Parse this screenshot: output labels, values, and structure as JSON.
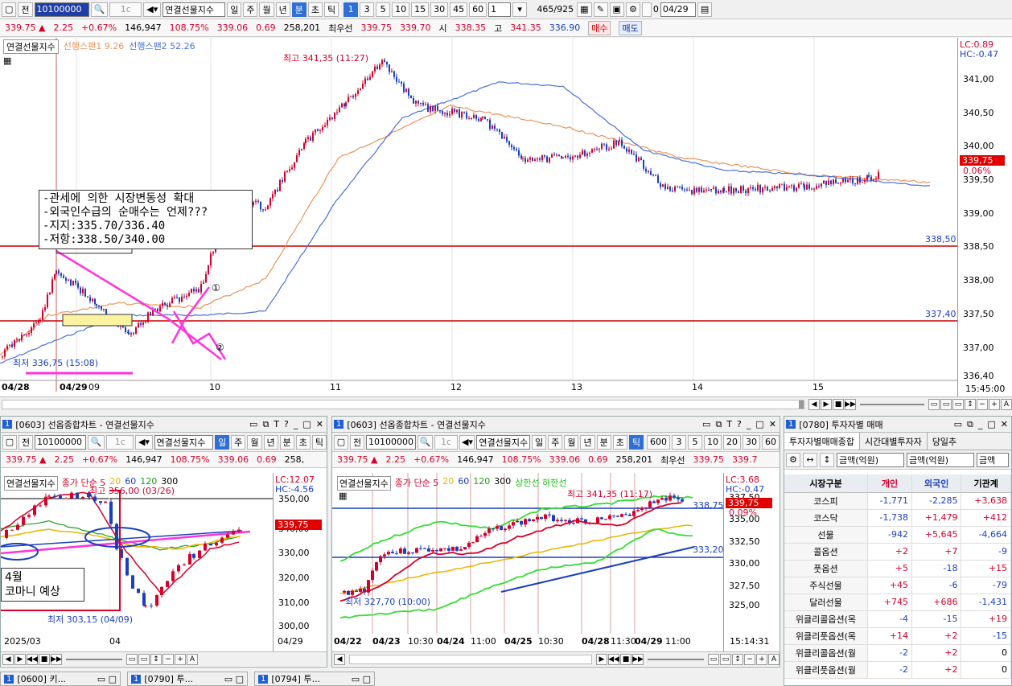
{
  "main": {
    "toolbar": {
      "btn_jeon": "전",
      "code": "10100000",
      "instrument": "연결선물지수",
      "periods": [
        "일",
        "주",
        "월",
        "년",
        "분",
        "초",
        "틱"
      ],
      "selected_period": "분",
      "intervals": [
        "1",
        "3",
        "5",
        "10",
        "15",
        "30",
        "45",
        "60"
      ],
      "selected_interval": "1",
      "count_value": "1",
      "page_info": "465/925",
      "date_value": "04/29",
      "zero_label": "0"
    },
    "quote": {
      "price": "339.75",
      "change": "2.25",
      "pct": "+0.67%",
      "volume": "146,947",
      "vol_ratio": "108.75%",
      "v1": "339.06",
      "v2": "0.69",
      "v3": "258,201",
      "best_label": "최우선",
      "ask": "339.75",
      "bid": "339.70",
      "open_label": "시",
      "open": "338.35",
      "high_label": "고",
      "high": "341.35",
      "low_val": "336.90",
      "buy": "매수",
      "sell": "매도"
    },
    "legend": {
      "instrument": "연결선물지수",
      "span1": "선행스팬1 9.26",
      "span2": "선행스팬2 52.26"
    },
    "lc": "LC:0.89",
    "hc": "HC:-0.47",
    "y_ticks": [
      "341,00",
      "340,50",
      "340,00",
      "339,50",
      "339,00",
      "338,50",
      "338,00",
      "337,50",
      "337,00",
      "336,40"
    ],
    "price_tag": "339,75",
    "price_tag_pct": "0.06%",
    "hline_labels": [
      "338,50",
      "337,40"
    ],
    "x_labels": [
      "04/28",
      "04/29",
      "09",
      "10",
      "11",
      "12",
      "13",
      "14",
      "15"
    ],
    "x_end": "15:45:00",
    "high_note": "최고 341,35 (11:27)",
    "low_note": "최저 336,75 (15:08)",
    "comment": [
      "-관세에 의한 시장변동성 확대",
      "-외국인수급의 순매수는 언제???",
      "-지지:335.70/336.40",
      "-저항:338.50/340.00"
    ],
    "mark1": "①",
    "mark2": "②"
  },
  "p1": {
    "title": "[0603] 선옵종합차트 - 연결선물지수",
    "num": "1",
    "code": "10100000",
    "instrument": "연결선물지수",
    "periods": [
      "일",
      "주",
      "월",
      "년",
      "분",
      "초",
      "틱"
    ],
    "selected": "일",
    "price": "339.75",
    "change": "2.25",
    "pct": "+0.67%",
    "volume": "146,947",
    "ratio": "108.75%",
    "v1": "339.06",
    "v2": "0.69",
    "v3": "258,",
    "legend": {
      "instrument": "연결선물지수",
      "ma": "종가 단순 5",
      "m20": "20",
      "m60": "60",
      "m120": "120",
      "m300": "300"
    },
    "lc": "LC:12.07",
    "hc": "HC:-4.56",
    "y_ticks": [
      "350,00",
      "340,00",
      "330,00",
      "320,00",
      "310,00",
      "300,00"
    ],
    "price_tag": "339,75",
    "high_note": "최고 356,00 (03/26)",
    "low_note": "최저 303,15 (04/09)",
    "note": [
      "4월",
      "코마니 예상"
    ],
    "x_labels": [
      "2025/03",
      "04"
    ],
    "x_end": "04/29"
  },
  "p2": {
    "title": "[0603] 선옵종합차트 - 연결선물지수",
    "num": "1",
    "code": "10100000",
    "instrument": "연결선물지수",
    "periods": [
      "일",
      "주",
      "월",
      "년",
      "분",
      "초",
      "틱"
    ],
    "selected": "틱",
    "intervals": [
      "600",
      "3",
      "5",
      "10",
      "20",
      "30",
      "60"
    ],
    "price": "339.75",
    "change": "2.25",
    "pct": "+0.67%",
    "volume": "146,947",
    "ratio": "108.75%",
    "v1": "339.06",
    "v2": "0.69",
    "v3": "258,201",
    "best": "최우선",
    "ask": "339.75",
    "bid": "339.7",
    "legend": {
      "instrument": "연결선물지수",
      "ma": "종가 단순 5",
      "m20": "20",
      "m60": "60",
      "m120": "120",
      "m300": "300",
      "band": "상한선 하한선"
    },
    "lc": "LC:3.68",
    "hc": "HC:-0.47",
    "y_ticks": [
      "337,50",
      "335,00",
      "332,50",
      "330,00",
      "327,50",
      "325,00"
    ],
    "price_tag": "339,75",
    "price_pct": "0.09%",
    "line_a": "338,75",
    "line_b": "333,20",
    "high_note": "최고 341,35 (11:17)",
    "low_note": "최저 327,70 (10:00)",
    "x_labels": [
      "04/22",
      "04/23",
      "10:30",
      "04/24",
      "11:00",
      "04/25",
      "10:30",
      "04/28",
      "11:30",
      "04/29",
      "11:00"
    ],
    "x_end": "15:14:31"
  },
  "p3": {
    "title": "[0780] 투자자별 매매",
    "num": "1",
    "tabs": [
      "투자자별매매종합",
      "시간대별투자자",
      "당일추"
    ],
    "sel1": "금액(억원)",
    "sel2": "금액(억원)",
    "sel3": "금액",
    "headers": [
      "시장구분",
      "개인",
      "외국인",
      "기관계"
    ],
    "rows": [
      [
        "코스피",
        "-1,771",
        "-2,285",
        "+3,638"
      ],
      [
        "코스닥",
        "-1,738",
        "+1,479",
        "+412"
      ],
      [
        "선물",
        "-942",
        "+5,645",
        "-4,664"
      ],
      [
        "콜옵션",
        "+2",
        "+7",
        "-9"
      ],
      [
        "풋옵션",
        "+5",
        "-18",
        "+15"
      ],
      [
        "주식선물",
        "+45",
        "-6",
        "-79"
      ],
      [
        "달러선물",
        "+745",
        "+686",
        "-1,431"
      ],
      [
        "위클리콜옵션(목",
        "-4",
        "-15",
        "+19"
      ],
      [
        "위클리풋옵션(목",
        "+14",
        "+2",
        "-15"
      ],
      [
        "위클리콜옵션(월",
        "-2",
        "+2",
        "0"
      ],
      [
        "위클리풋옵션(월",
        "-2",
        "+2",
        "0"
      ]
    ]
  },
  "taskbar": [
    {
      "num": "1",
      "label": "[0600] 키..."
    },
    {
      "num": "1",
      "label": "[0790] 투..."
    },
    {
      "num": "1",
      "label": "[0794] 투..."
    }
  ],
  "colors": {
    "up": "#d6002a",
    "down": "#1a3fc0",
    "span1": "#e8945a",
    "span2": "#4a70d8",
    "magenta": "#ff33dd",
    "hline": "#c80000"
  }
}
